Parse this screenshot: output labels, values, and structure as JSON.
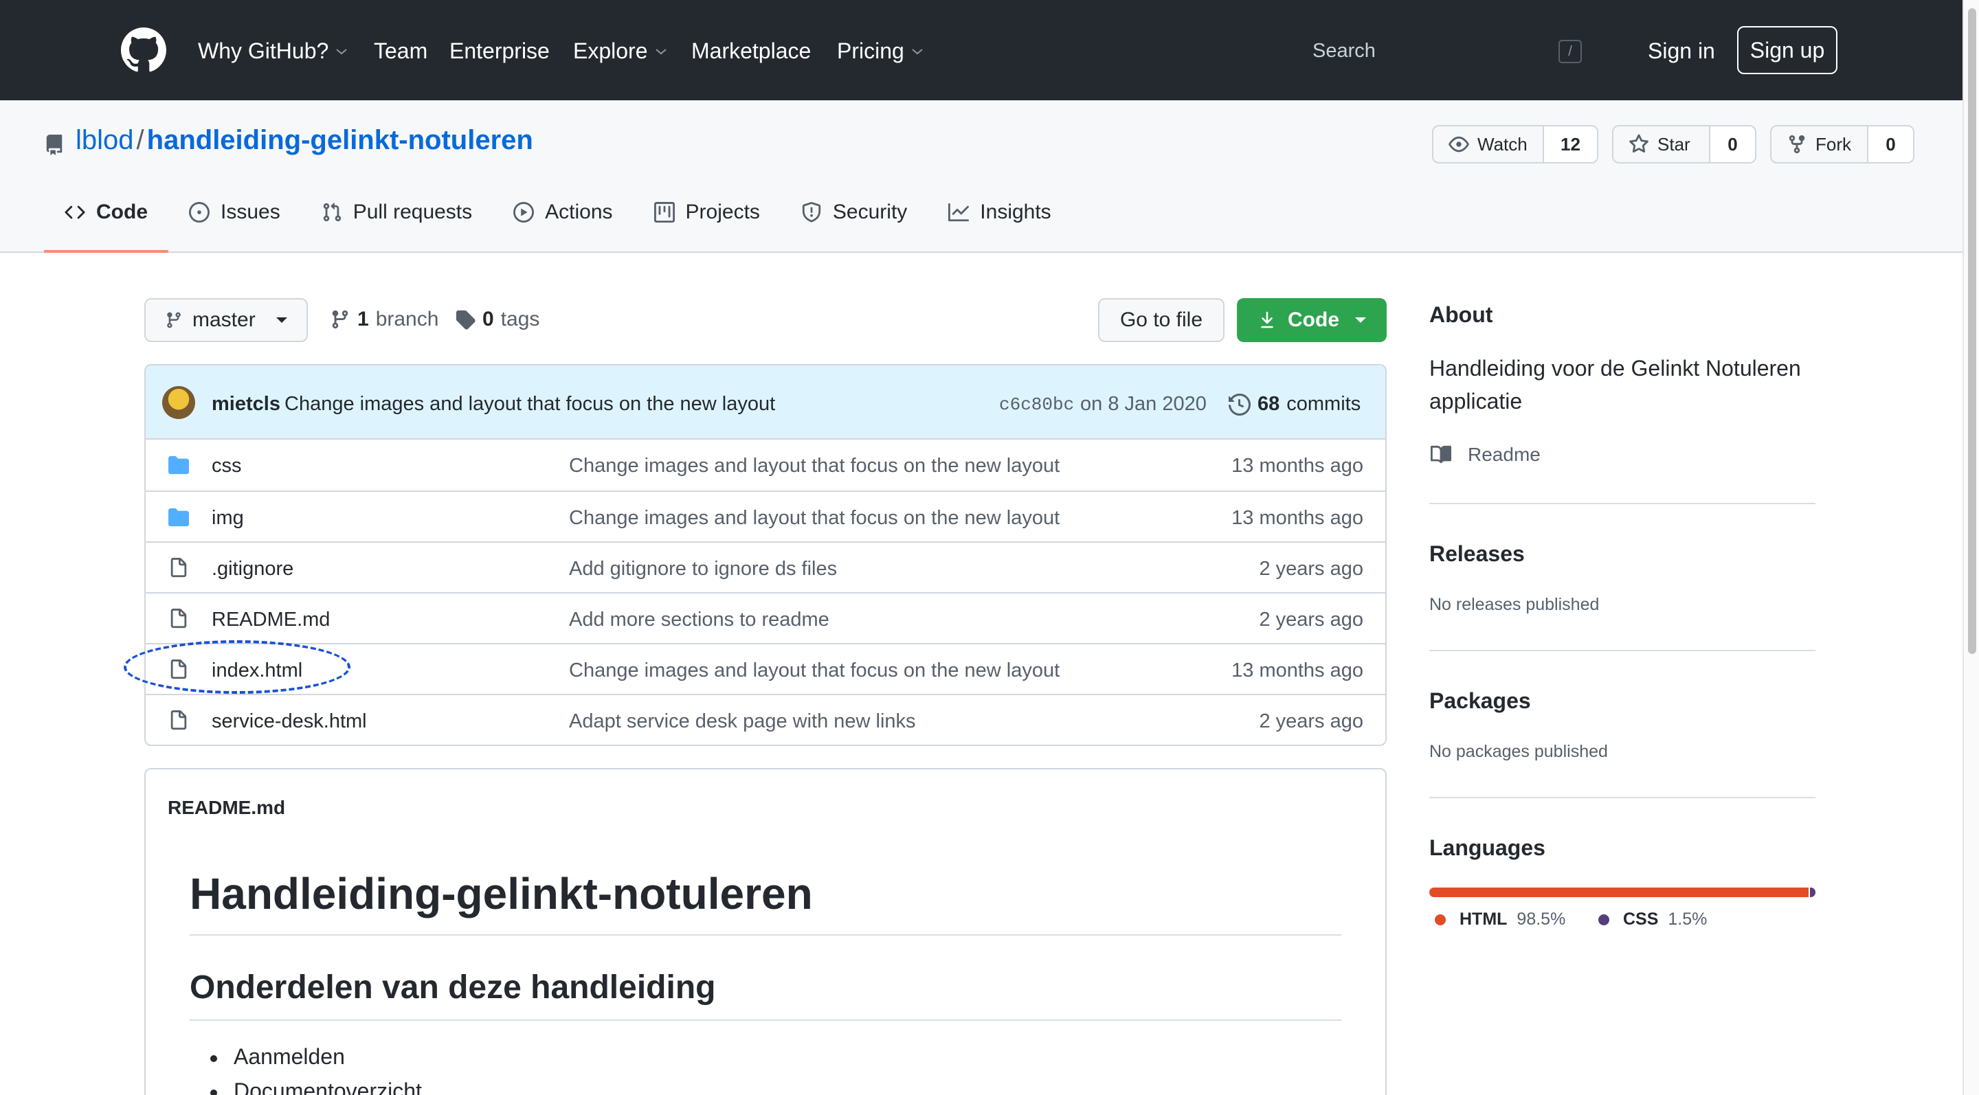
{
  "header": {
    "nav": [
      {
        "label": "Why GitHub?",
        "dropdown": true
      },
      {
        "label": "Team",
        "dropdown": false
      },
      {
        "label": "Enterprise",
        "dropdown": false
      },
      {
        "label": "Explore",
        "dropdown": true
      },
      {
        "label": "Marketplace",
        "dropdown": false
      },
      {
        "label": "Pricing",
        "dropdown": true
      }
    ],
    "search_placeholder": "Search",
    "search_shortcut": "/",
    "sign_in": "Sign in",
    "sign_up": "Sign up"
  },
  "repo": {
    "owner": "lblod",
    "separator": "/",
    "name": "handleiding-gelinkt-notuleren",
    "watch_label": "Watch",
    "watch_count": "12",
    "star_label": "Star",
    "star_count": "0",
    "fork_label": "Fork",
    "fork_count": "0",
    "tabs": [
      {
        "label": "Code",
        "icon": "code-icon",
        "active": true
      },
      {
        "label": "Issues",
        "icon": "issue-icon",
        "active": false
      },
      {
        "label": "Pull requests",
        "icon": "pull-request-icon",
        "active": false
      },
      {
        "label": "Actions",
        "icon": "play-icon",
        "active": false
      },
      {
        "label": "Projects",
        "icon": "project-icon",
        "active": false
      },
      {
        "label": "Security",
        "icon": "shield-icon",
        "active": false
      },
      {
        "label": "Insights",
        "icon": "graph-icon",
        "active": false
      }
    ]
  },
  "toolbar": {
    "branch": "master",
    "branch_count": "1",
    "branch_label": "branch",
    "tag_count": "0",
    "tag_label": "tags",
    "go_to_file": "Go to file",
    "code_button": "Code"
  },
  "latest_commit": {
    "author": "mietcls",
    "message": "Change images and layout that focus on the new layout",
    "sha": "c6c80bc",
    "date": "on 8 Jan 2020",
    "commit_count": "68",
    "commit_label": "commits"
  },
  "files": [
    {
      "type": "folder",
      "name": "css",
      "message": "Change images and layout that focus on the new layout",
      "age": "13 months ago"
    },
    {
      "type": "folder",
      "name": "img",
      "message": "Change images and layout that focus on the new layout",
      "age": "13 months ago"
    },
    {
      "type": "file",
      "name": ".gitignore",
      "message": "Add gitignore to ignore ds files",
      "age": "2 years ago"
    },
    {
      "type": "file",
      "name": "README.md",
      "message": "Add more sections to readme",
      "age": "2 years ago"
    },
    {
      "type": "file",
      "name": "index.html",
      "message": "Change images and layout that focus on the new layout",
      "age": "13 months ago"
    },
    {
      "type": "file",
      "name": "service-desk.html",
      "message": "Adapt service desk page with new links",
      "age": "2 years ago"
    }
  ],
  "readme": {
    "filename": "README.md",
    "h1": "Handleiding-gelinkt-notuleren",
    "h2": "Onderdelen van deze handleiding",
    "items": [
      "Aanmelden",
      "Documentoverzicht"
    ]
  },
  "sidebar": {
    "about_heading": "About",
    "description": "Handleiding voor de Gelinkt Notuleren applicatie",
    "readme_link": "Readme",
    "releases_heading": "Releases",
    "releases_text": "No releases published",
    "packages_heading": "Packages",
    "packages_text": "No packages published",
    "languages_heading": "Languages",
    "languages": [
      {
        "name": "HTML",
        "percent": "98.5%",
        "value": 98.5,
        "color": "#e34c26"
      },
      {
        "name": "CSS",
        "percent": "1.5%",
        "value": 1.5,
        "color": "#563d7c"
      }
    ]
  },
  "colors": {
    "header_bg": "#24292f",
    "link": "#0969da",
    "primary_button": "#2da44e",
    "active_tab_underline": "#fd8c73",
    "folder_icon": "#54aeff",
    "highlight_ring": "#1a4fd6"
  }
}
